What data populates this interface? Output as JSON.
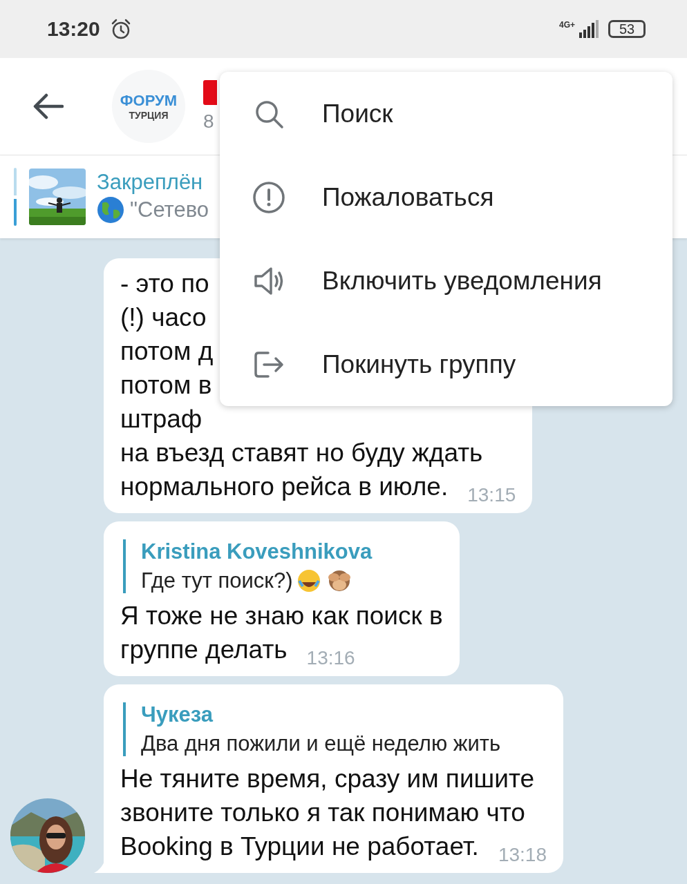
{
  "status_bar": {
    "time": "13:20",
    "network": "4G+",
    "battery": "53"
  },
  "header": {
    "logo_top": "ФОРУМ",
    "logo_bottom": "ТУРЦИЯ",
    "subtitle": "8"
  },
  "pinned": {
    "title": "Закреплён",
    "text": "\"Сетево"
  },
  "messages": [
    {
      "lines": [
        "- это по",
        "(!) часо",
        "потом д",
        "потом в",
        "штраф",
        "на въезд ставят но буду ждать",
        "нормального рейса в июле."
      ],
      "time": "13:15"
    },
    {
      "reply": {
        "author": "Kristina Koveshnikova",
        "text": "Где тут поиск?)",
        "emoji": [
          {
            "kind": "laughing"
          },
          {
            "kind": "monkey"
          }
        ]
      },
      "lines": [
        "Я тоже не знаю как поиск в",
        "группе делать"
      ],
      "time": "13:16"
    },
    {
      "reply": {
        "author": "Чукеза",
        "text": "Два дня пожили и ещё неделю жить"
      },
      "lines": [
        "Не тяните время, сразу им пишите",
        "звоните только я так понимаю что",
        "Booking в Турции не работает."
      ],
      "time": "13:18",
      "avatar": true
    }
  ],
  "menu": [
    {
      "kind": "search",
      "label": "Поиск"
    },
    {
      "kind": "report",
      "label": "Пожаловаться"
    },
    {
      "kind": "sound",
      "label": "Включить уведомления"
    },
    {
      "kind": "leave",
      "label": "Покинуть группу"
    }
  ]
}
